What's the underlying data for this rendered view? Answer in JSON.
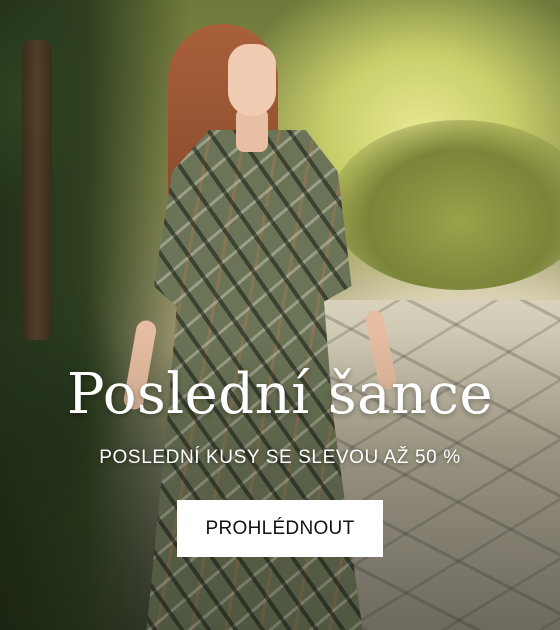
{
  "banner": {
    "headline": "Poslední šance",
    "subheadline": "POSLEDNÍ KUSY SE SLEVOU AŽ 50 %",
    "cta_label": "PROHLÉDNOUT"
  },
  "colors": {
    "text": "#ffffff",
    "button_bg": "#ffffff",
    "button_text": "#111111"
  }
}
